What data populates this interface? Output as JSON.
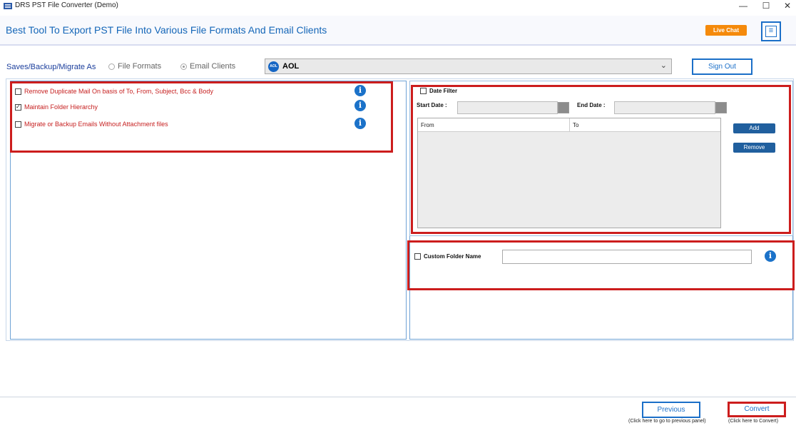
{
  "window": {
    "title": "DRS PST File Converter (Demo)",
    "minimize": "—",
    "maximize": "☐",
    "close": "✕"
  },
  "header": {
    "title": "Best Tool To Export PST File Into Various File Formats And Email Clients",
    "live_chat": "Live Chat",
    "menu_icon": "≡"
  },
  "save_as": {
    "label": "Saves/Backup/Migrate As",
    "options": [
      {
        "label": "File Formats",
        "selected": false
      },
      {
        "label": "Email Clients",
        "selected": true
      }
    ],
    "client": {
      "icon_text": "AOL",
      "value": "AOL"
    },
    "sign_out": "Sign Out"
  },
  "options": [
    {
      "label": "Remove Duplicate Mail On basis of To, From, Subject, Bcc & Body",
      "checked": false
    },
    {
      "label": "Maintain Folder Hierarchy",
      "checked": true
    },
    {
      "label": "Migrate or Backup Emails Without Attachment files",
      "checked": false
    }
  ],
  "date_filter": {
    "label": "Date Filter",
    "checked": false,
    "start_label": "Start Date :",
    "end_label": "End Date :",
    "columns": [
      "From",
      "To"
    ],
    "add": "Add",
    "remove": "Remove"
  },
  "custom_folder": {
    "label": "Custom Folder Name",
    "checked": false,
    "value": ""
  },
  "info_icon": "i",
  "footer": {
    "previous": "Previous",
    "previous_hint": "(Click here to go to previous panel)",
    "convert": "Convert",
    "convert_hint": "(Click here to Convert)"
  },
  "colors": {
    "accent": "#1b6fc8",
    "highlight": "#cc1d1d",
    "live_chat": "#f58a0b"
  }
}
